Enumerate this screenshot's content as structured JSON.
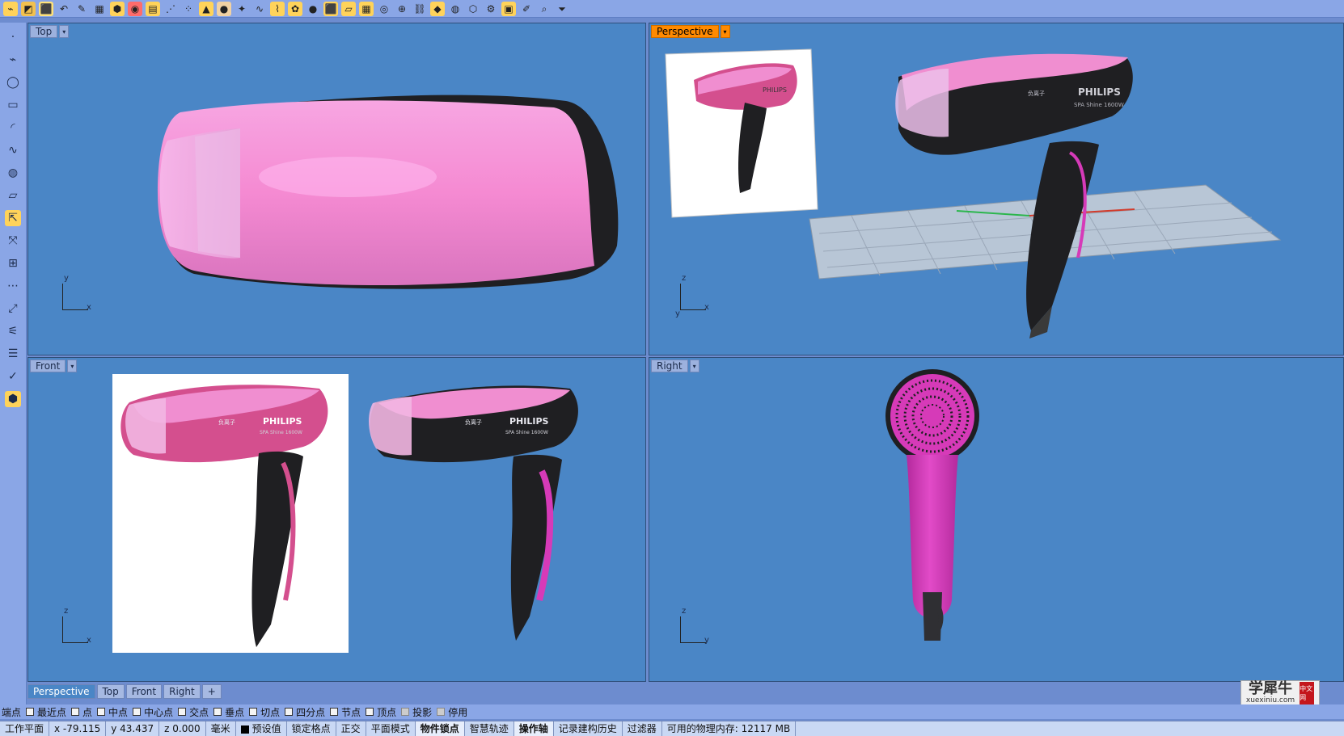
{
  "toolbar_top": {
    "icons": [
      "snap-icon",
      "select-icon",
      "cube-icon",
      "undo-icon",
      "pen-icon",
      "grid-icon",
      "box-icon",
      "color-icon",
      "layer-icon",
      "dots-icon",
      "points-icon",
      "shape-icon",
      "sphere-icon",
      "spark-icon",
      "curve-icon",
      "brush-icon",
      "palette-icon",
      "black-sphere-icon",
      "box2-icon",
      "plane-icon",
      "grid2-icon",
      "spiral-icon",
      "target-icon",
      "chain-icon",
      "paint-icon",
      "globe-icon",
      "cube2-icon",
      "settings-icon",
      "stack-icon",
      "brush2-icon",
      "zoom-icon",
      "filter-icon"
    ]
  },
  "toolbar_left": {
    "icons": [
      "point-icon",
      "polyline-icon",
      "circle-icon",
      "rectangle-icon",
      "arc-icon",
      "curve-tool-icon",
      "sphere-tool-icon",
      "surface-icon",
      "extrude-icon",
      "move-icon",
      "scale-icon",
      "array-icon",
      "transform-icon",
      "wire-icon",
      "layers-icon",
      "check-icon",
      "paint-tool-icon"
    ]
  },
  "viewports": {
    "top": {
      "label": "Top",
      "axes": [
        "y",
        "x"
      ]
    },
    "perspective": {
      "label": "Perspective",
      "axes": [
        "z",
        "x"
      ],
      "axes_extra": "y"
    },
    "front": {
      "label": "Front",
      "axes": [
        "z",
        "x"
      ]
    },
    "right": {
      "label": "Right",
      "axes": [
        "z",
        "y"
      ]
    }
  },
  "hairdryer": {
    "brand": "PHILIPS",
    "sub_brand": "负离子",
    "model": "SPA Shine 1600W",
    "colors": {
      "pink": "#f08ed0",
      "dark": "#1f1f22",
      "magenta": "#d63ab8",
      "paper": "#ffffff",
      "viewport_blue": "#4a86c6"
    }
  },
  "tabs": [
    "Perspective",
    "Top",
    "Front",
    "Right",
    "+"
  ],
  "osnap": {
    "first_label": "端点",
    "items": [
      "最近点",
      "点",
      "中点",
      "中心点",
      "交点",
      "垂点",
      "切点",
      "四分点",
      "节点",
      "顶点",
      "投影",
      "停用"
    ]
  },
  "status": [
    {
      "label": "工作平面",
      "bold": false
    },
    {
      "label": "x -79.115",
      "bold": false
    },
    {
      "label": "y 43.437",
      "bold": false
    },
    {
      "label": "z 0.000",
      "bold": false
    },
    {
      "label": "毫米",
      "bold": false
    },
    {
      "label": "预设值",
      "bold": false
    },
    {
      "label": "锁定格点",
      "bold": false
    },
    {
      "label": "正交",
      "bold": false
    },
    {
      "label": "平面模式",
      "bold": false
    },
    {
      "label": "物件锁点",
      "bold": true
    },
    {
      "label": "智慧轨迹",
      "bold": false
    },
    {
      "label": "操作轴",
      "bold": true
    },
    {
      "label": "记录建构历史",
      "bold": false
    },
    {
      "label": "过滤器",
      "bold": false
    },
    {
      "label": "可用的物理内存: 12117 MB",
      "bold": false
    }
  ],
  "watermark": {
    "title": "学犀牛",
    "sub": "xuexiniu.com",
    "badge": "中文网"
  }
}
